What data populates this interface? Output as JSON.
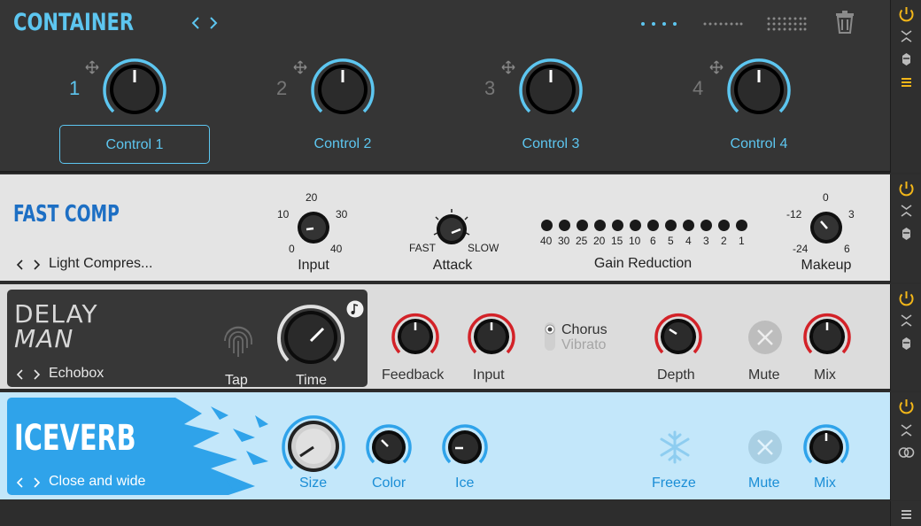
{
  "container": {
    "title": "CONTAINER",
    "nav": "< >",
    "slots": [
      {
        "number": "1",
        "label": "Control 1",
        "selected": true
      },
      {
        "number": "2",
        "label": "Control 2",
        "selected": false
      },
      {
        "number": "3",
        "label": "Control 3",
        "selected": false
      },
      {
        "number": "4",
        "label": "Control 4",
        "selected": false
      }
    ]
  },
  "fastcomp": {
    "title": "FAST COMP",
    "preset": "Light Compres...",
    "input": {
      "label": "Input",
      "ticks": [
        "0",
        "10",
        "20",
        "30",
        "40"
      ]
    },
    "attack": {
      "label": "Attack",
      "min": "FAST",
      "max": "SLOW"
    },
    "gain_reduction": {
      "label": "Gain Reduction",
      "scale": [
        "40",
        "30",
        "25",
        "20",
        "15",
        "10",
        "6",
        "5",
        "4",
        "3",
        "2",
        "1"
      ]
    },
    "makeup": {
      "label": "Makeup",
      "ticks": [
        "-24",
        "-12",
        "0",
        "3",
        "6"
      ]
    }
  },
  "delayman": {
    "title_line1": "DELAY",
    "title_line2": "MAN",
    "preset": "Echobox",
    "tap_label": "Tap",
    "time_label": "Time",
    "feedback_label": "Feedback",
    "input_label": "Input",
    "mode_options": [
      "Chorus",
      "Vibrato"
    ],
    "mode_selected": "Chorus",
    "depth_label": "Depth",
    "mute_label": "Mute",
    "mix_label": "Mix"
  },
  "iceverb": {
    "title": "ICEVERB",
    "preset": "Close and wide",
    "size_label": "Size",
    "color_label": "Color",
    "ice_label": "Ice",
    "freeze_label": "Freeze",
    "mute_label": "Mute",
    "mix_label": "Mix"
  },
  "colors": {
    "accent_blue": "#5dc6f0",
    "power_yellow": "#f2b619",
    "knob_red": "#d32228",
    "fastcomp_blue": "#1d6fc4",
    "iceverb_blue": "#2fa3ea"
  }
}
